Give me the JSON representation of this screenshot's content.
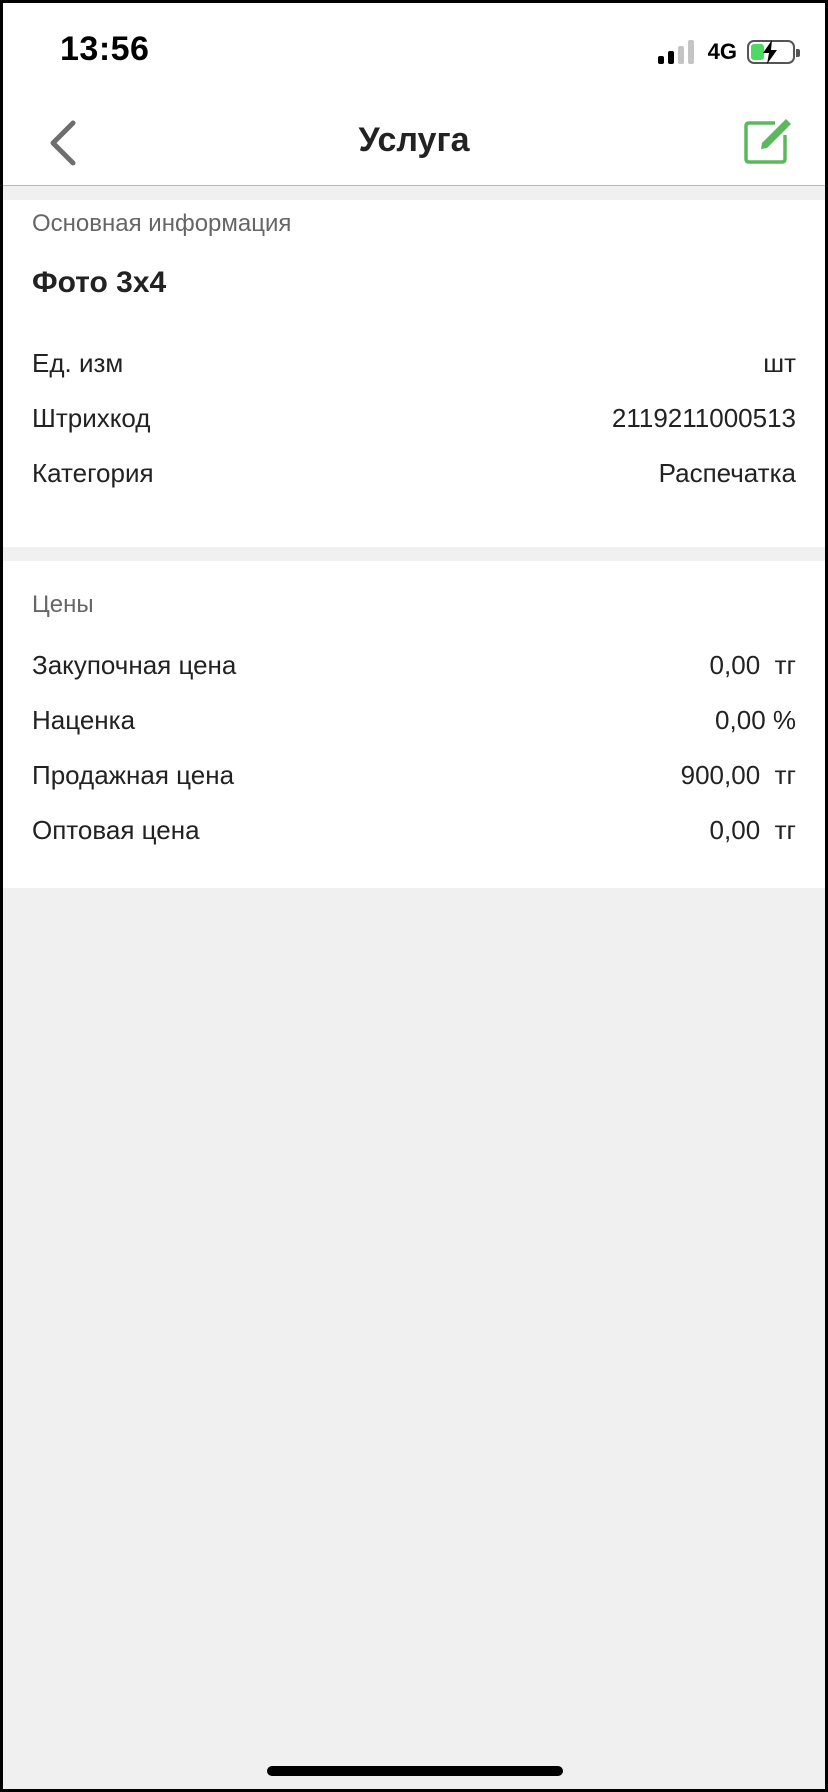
{
  "status_bar": {
    "time": "13:56",
    "network": "4G",
    "signal_icon": "cellular-signal-icon",
    "battery_icon": "battery-charging-icon",
    "battery_color": "#4cd964"
  },
  "nav": {
    "title": "Услуга",
    "back_icon": "chevron-left-icon",
    "edit_icon": "edit-icon",
    "accent_color": "#5cb85c"
  },
  "main_info": {
    "section_title": "Основная информация",
    "item_name": "Фото 3х4",
    "rows": [
      {
        "label": "Ед. изм",
        "value": "шт"
      },
      {
        "label": "Штрихкод",
        "value": "2119211000513"
      },
      {
        "label": "Категория",
        "value": "Распечатка"
      }
    ]
  },
  "prices": {
    "section_title": "Цены",
    "rows": [
      {
        "label": "Закупочная цена",
        "value": "0,00  тг"
      },
      {
        "label": "Наценка",
        "value": "0,00 %"
      },
      {
        "label": "Продажная цена",
        "value": "900,00  тг"
      },
      {
        "label": "Оптовая цена",
        "value": "0,00  тг"
      }
    ]
  }
}
